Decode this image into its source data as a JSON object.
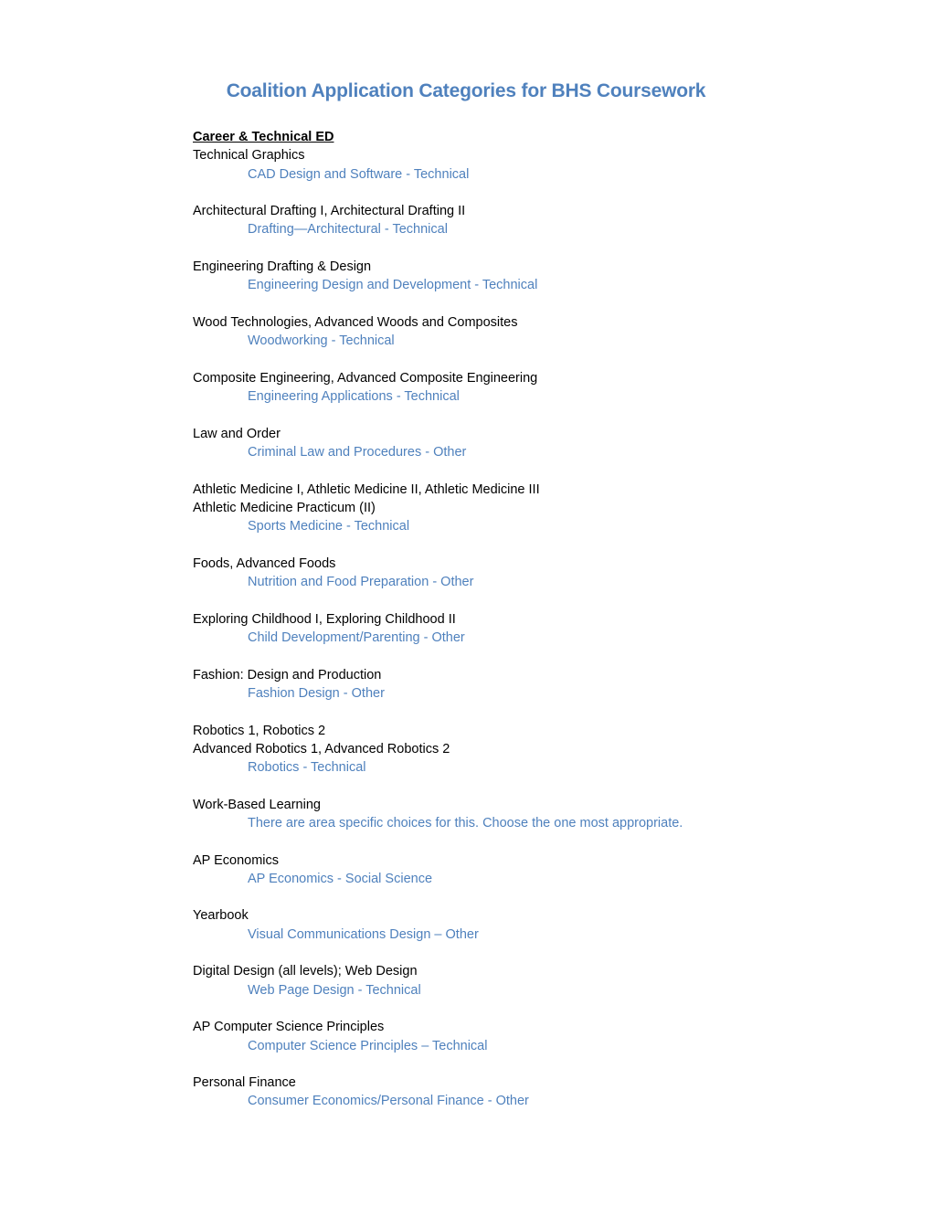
{
  "title": "Coalition Application Categories for BHS Coursework",
  "section_heading": "Career & Technical ED",
  "entries": [
    {
      "courses": [
        "Technical Graphics"
      ],
      "category": "CAD Design and Software - Technical"
    },
    {
      "courses": [
        "Architectural Drafting I, Architectural Drafting II"
      ],
      "category": "Drafting—Architectural - Technical"
    },
    {
      "courses": [
        "Engineering Drafting & Design"
      ],
      "category": "Engineering Design and Development - Technical"
    },
    {
      "courses": [
        "Wood Technologies, Advanced Woods and Composites"
      ],
      "category": "Woodworking - Technical"
    },
    {
      "courses": [
        "Composite Engineering, Advanced Composite Engineering"
      ],
      "category": "Engineering Applications - Technical"
    },
    {
      "courses": [
        "Law and Order"
      ],
      "category": "Criminal Law and Procedures - Other"
    },
    {
      "courses": [
        "Athletic Medicine I, Athletic Medicine II, Athletic Medicine III",
        "Athletic Medicine Practicum (II)"
      ],
      "category": "Sports Medicine - Technical"
    },
    {
      "courses": [
        "Foods, Advanced Foods"
      ],
      "category": "Nutrition and Food Preparation - Other"
    },
    {
      "courses": [
        "Exploring Childhood I, Exploring Childhood II"
      ],
      "category": "Child Development/Parenting - Other"
    },
    {
      "courses": [
        "Fashion: Design and Production"
      ],
      "category": "Fashion Design - Other"
    },
    {
      "courses": [
        "Robotics 1, Robotics 2",
        "Advanced Robotics 1, Advanced Robotics 2"
      ],
      "category": "Robotics - Technical"
    },
    {
      "courses": [
        "Work-Based Learning"
      ],
      "category": "There are area specific choices for this.  Choose the one most appropriate."
    },
    {
      "courses": [
        "AP Economics"
      ],
      "category": "AP Economics - Social Science"
    },
    {
      "courses": [
        "Yearbook"
      ],
      "category": "Visual Communications Design – Other"
    },
    {
      "courses": [
        "Digital Design (all levels); Web Design"
      ],
      "category": "Web Page Design - Technical"
    },
    {
      "courses": [
        "AP Computer Science Principles"
      ],
      "category": "Computer Science Principles – Technical"
    },
    {
      "courses": [
        "Personal Finance"
      ],
      "category": "Consumer Economics/Personal Finance - Other"
    }
  ],
  "colors": {
    "title": "#4f81bd",
    "category": "#4f81bd",
    "body_text": "#000000"
  }
}
